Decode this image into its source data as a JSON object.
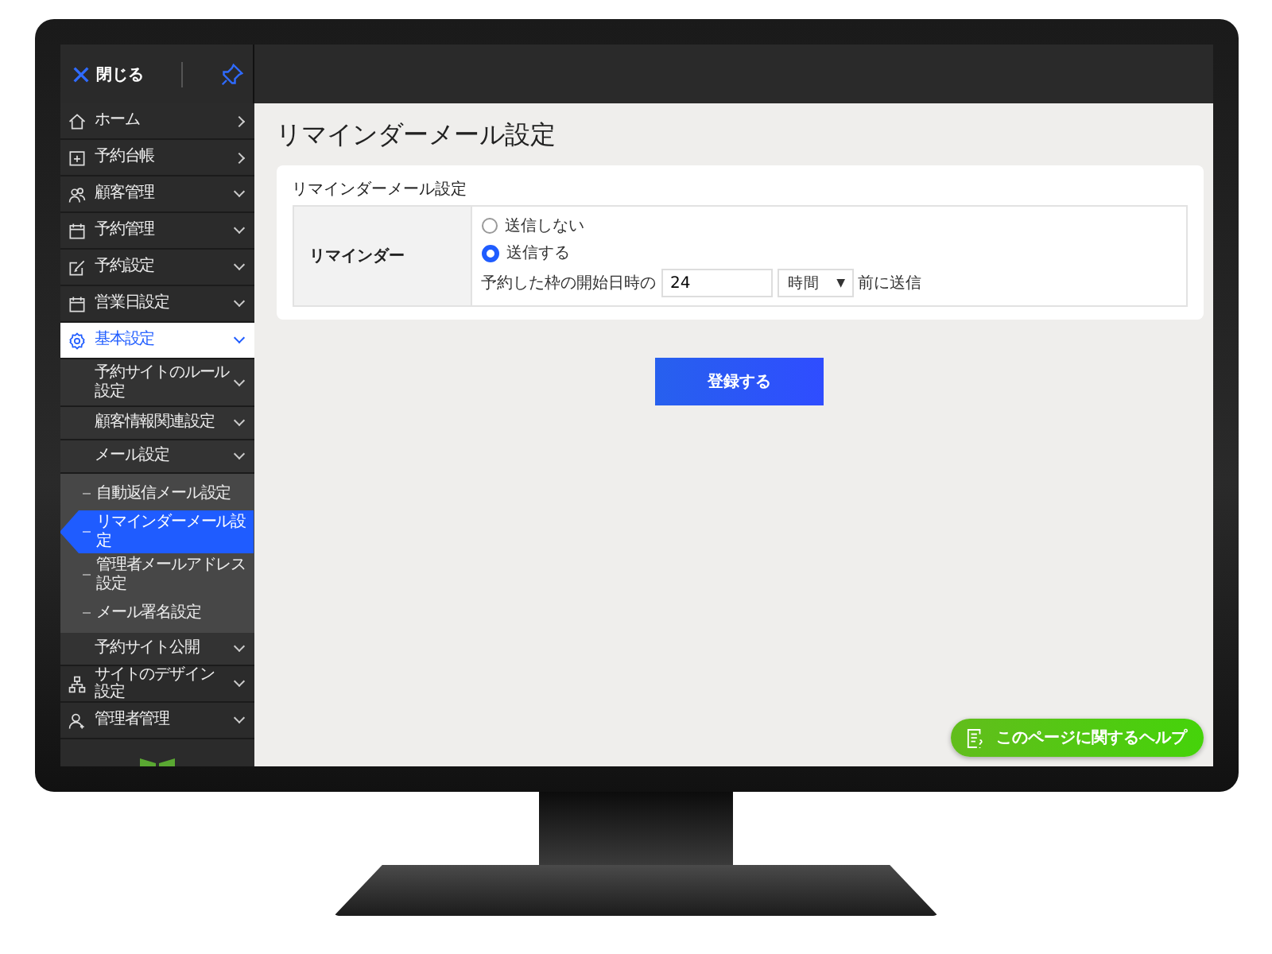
{
  "topbar": {
    "close_label": "閉じる"
  },
  "sidebar": {
    "items": [
      {
        "label": "ホーム",
        "kind": "link",
        "selected": false
      },
      {
        "label": "予約台帳",
        "kind": "link",
        "selected": false
      },
      {
        "label": "顧客管理",
        "kind": "group",
        "selected": false
      },
      {
        "label": "予約管理",
        "kind": "group",
        "selected": false
      },
      {
        "label": "予約設定",
        "kind": "group",
        "selected": false
      },
      {
        "label": "営業日設定",
        "kind": "group",
        "selected": false
      },
      {
        "label": "基本設定",
        "kind": "group",
        "selected": true,
        "children": [
          {
            "label": "予約サイトのルール設定",
            "kind": "group",
            "selected": false
          },
          {
            "label": "顧客情報関連設定",
            "kind": "group",
            "selected": false
          },
          {
            "label": "メール設定",
            "kind": "group",
            "selected": false,
            "children": [
              {
                "label": "自動返信メール設定",
                "selected": false
              },
              {
                "label": "リマインダーメール設定",
                "selected": true
              },
              {
                "label": "管理者メールアドレス設定",
                "selected": false
              },
              {
                "label": "メール署名設定",
                "selected": false
              }
            ]
          },
          {
            "label": "予約サイト公開",
            "kind": "group",
            "selected": false
          }
        ]
      },
      {
        "label": "サイトのデザイン設定",
        "kind": "group",
        "selected": false
      },
      {
        "label": "管理者管理",
        "kind": "group",
        "selected": false
      }
    ]
  },
  "page_title": "リマインダーメール設定",
  "form": {
    "section_title": "リマインダーメール設定",
    "row_label": "リマインダー",
    "options": [
      {
        "label": "送信しない",
        "selected": false
      },
      {
        "label": "送信する",
        "selected": true
      }
    ],
    "timing": {
      "prefix": "予約した枠の開始日時の",
      "value": "24",
      "unit": "時間",
      "unit_caret": "▼",
      "suffix": "前に送信"
    }
  },
  "submit_label": "登録する",
  "help_label": "このページに関するヘルプ"
}
